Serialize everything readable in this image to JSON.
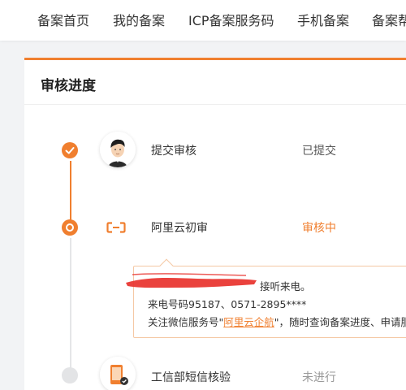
{
  "nav": {
    "items": [
      "备案首页",
      "我的备案",
      "ICP备案服务码",
      "手机备案",
      "备案帮"
    ]
  },
  "card": {
    "title": "审核进度"
  },
  "steps": [
    {
      "name": "提交审核",
      "status": "已提交"
    },
    {
      "name": "阿里云初审",
      "status": "审核中"
    },
    {
      "name": "工信部短信核验",
      "status": "未进行"
    }
  ],
  "notice": {
    "line1_tail": "接听来电。",
    "line2": "来电号码95187、0571-2895****",
    "line3_prefix": "关注微信服务号\"",
    "line3_link": "阿里云企航",
    "line3_suffix": "\"，随时查询备案进度、申请服务"
  },
  "colors": {
    "accent": "#f07f2f",
    "pending": "#e3e4e6",
    "redaction": "#e8322d"
  }
}
